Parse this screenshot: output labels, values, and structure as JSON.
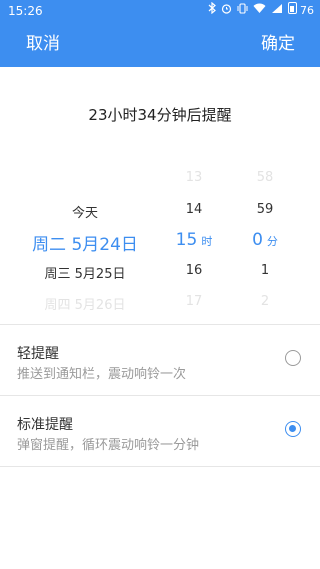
{
  "status_bar": {
    "time": "15:26",
    "battery": "76",
    "icons": [
      "bluetooth-icon",
      "alarm-icon",
      "vibrate-icon",
      "wifi-icon",
      "signal-icon",
      "battery-icon"
    ]
  },
  "header": {
    "cancel_label": "取消",
    "confirm_label": "确定",
    "background_color": "#3d8ef0"
  },
  "summary_text": "23小时34分钟后提醒",
  "picker": {
    "date": {
      "above_faint": "",
      "above": "今天",
      "selected": "周二 5月24日",
      "below": "周三 5月25日",
      "below_faint": "周四 5月26日"
    },
    "hour": {
      "above_faint": "13",
      "above": "14",
      "selected": "15",
      "unit": "时",
      "below": "16",
      "below_faint": "17"
    },
    "minute": {
      "above_faint": "58",
      "above": "59",
      "selected": "0",
      "unit": "分",
      "below": "1",
      "below_faint": "2"
    },
    "selected_color": "#3d8ef0"
  },
  "options": [
    {
      "title": "轻提醒",
      "description": "推送到通知栏，震动响铃一次",
      "selected": false
    },
    {
      "title": "标准提醒",
      "description": "弹窗提醒，循环震动响铃一分钟",
      "selected": true
    }
  ]
}
